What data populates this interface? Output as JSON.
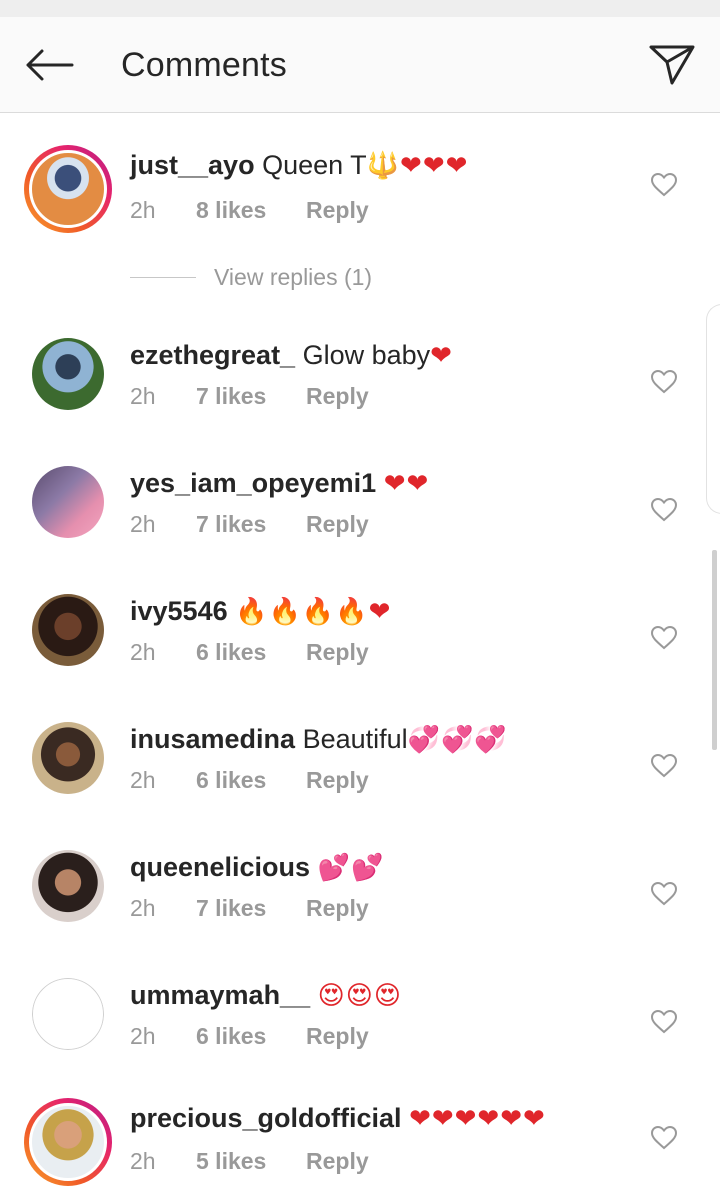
{
  "header": {
    "title": "Comments",
    "back_icon": "arrow-left-icon",
    "send_icon": "paper-plane-icon"
  },
  "comments": [
    {
      "username": "just__ayo",
      "text": "Queen T",
      "emoji": "🔱❤❤❤",
      "time": "2h",
      "likes": "8 likes",
      "reply": "Reply",
      "view_replies": "View replies (1)"
    },
    {
      "username": "ezethegreat_",
      "text": "Glow baby",
      "emoji": "❤",
      "time": "2h",
      "likes": "7 likes",
      "reply": "Reply"
    },
    {
      "username": "yes_iam_opeyemi1",
      "text": "",
      "emoji": "❤❤",
      "time": "2h",
      "likes": "7 likes",
      "reply": "Reply"
    },
    {
      "username": "ivy5546",
      "text": "",
      "emoji": "🔥🔥🔥🔥❤",
      "time": "2h",
      "likes": "6 likes",
      "reply": "Reply"
    },
    {
      "username": "inusamedina",
      "text": "Beautiful",
      "emoji": "💞💞💞",
      "time": "2h",
      "likes": "6 likes",
      "reply": "Reply"
    },
    {
      "username": "queenelicious",
      "text": "",
      "emoji": "💕💕",
      "time": "2h",
      "likes": "7 likes",
      "reply": "Reply"
    },
    {
      "username": "ummaymah__",
      "text": "",
      "emoji": "😍😍😍",
      "time": "2h",
      "likes": "6 likes",
      "reply": "Reply"
    },
    {
      "username": "precious_goldofficial",
      "text": "",
      "emoji": "❤❤❤❤❤❤",
      "time": "2h",
      "likes": "5 likes",
      "reply": "Reply"
    }
  ],
  "colors": {
    "text": "#262626",
    "meta": "#999999",
    "heart_emoji": "#e0262b",
    "story_ring_start": "#f9a12e",
    "story_ring_end": "#b21d8a"
  }
}
